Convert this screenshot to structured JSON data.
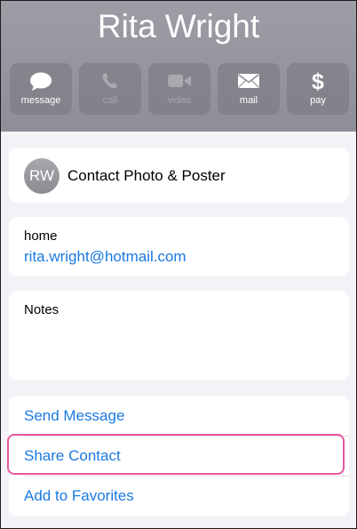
{
  "contact": {
    "name": "Rita Wright",
    "initials": "RW"
  },
  "actions": [
    {
      "label": "message",
      "icon": "message-icon",
      "enabled": true
    },
    {
      "label": "call",
      "icon": "phone-icon",
      "enabled": false
    },
    {
      "label": "video",
      "icon": "video-camera-icon",
      "enabled": false
    },
    {
      "label": "mail",
      "icon": "envelope-icon",
      "enabled": true
    },
    {
      "label": "pay",
      "icon": "dollar-icon",
      "enabled": true,
      "glyph": "$"
    }
  ],
  "poster": {
    "label": "Contact Photo & Poster"
  },
  "email": {
    "label": "home",
    "value": "rita.wright@hotmail.com"
  },
  "notes": {
    "label": "Notes"
  },
  "menu": {
    "send_message": "Send Message",
    "share_contact": "Share Contact",
    "add_to_favorites": "Add to Favorites"
  },
  "colors": {
    "header": "#8e8e98",
    "link": "#1a7ae2",
    "highlight": "#e8589c",
    "background": "#f2f2f7"
  }
}
